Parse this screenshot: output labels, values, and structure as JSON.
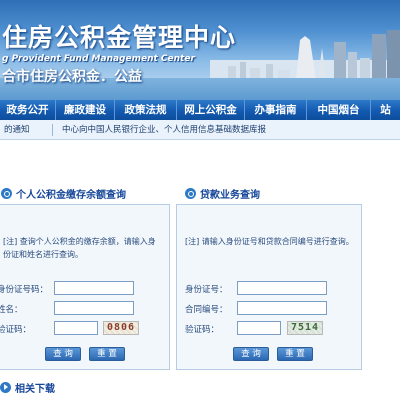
{
  "banner": {
    "title": "住房公积金管理中心",
    "subtitle_en": "g Provident Fund Management Center",
    "slogan": "合市住房公积金．公益"
  },
  "nav": {
    "items": [
      "政务公开",
      "廉政建设",
      "政策法规",
      "网上公积金",
      "办事指南",
      "中国烟台",
      "站"
    ]
  },
  "notice": {
    "left": "的通知",
    "right": "中心向中国人民银行企业、个人信用信息基础数据库报"
  },
  "balance_panel": {
    "title": "个人公积金缴存余额查询",
    "note": "[注] 查询个人公积金的缴存余额，请输入身份证和姓名进行查询。",
    "id_label": "身份证号码：",
    "name_label": "姓名：",
    "code_label": "验证码：",
    "captcha": "0806",
    "query_label": "查 询",
    "reset_label": "重 置"
  },
  "loan_panel": {
    "title": "贷款业务查询",
    "note": "[注] 请输入身份证号和贷款合同编号进行查询。",
    "id_label": "身份证号：",
    "contract_label": "合同编号：",
    "code_label": "验证码：",
    "captcha": "7514",
    "query_label": "查 询",
    "reset_label": "重 置"
  },
  "downloads": {
    "title": "相关下载"
  },
  "colors": {
    "nav_bg": "#135ab0",
    "panel_bg": "#f2f7fc",
    "heading": "#17479a",
    "button": "#2b68b2"
  }
}
